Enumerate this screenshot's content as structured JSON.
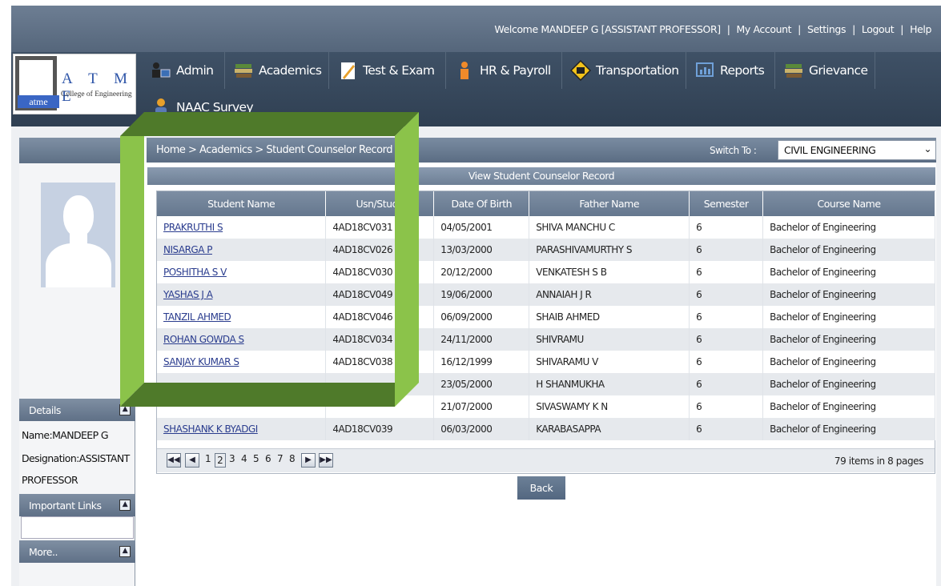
{
  "header": {
    "welcome": "Welcome MANDEEP G [ASSISTANT PROFESSOR]",
    "links": [
      "My Account",
      "Settings",
      "Logout",
      "Help"
    ]
  },
  "logo": {
    "letters": "A T M E",
    "subtitle": "College of Engineering",
    "badge": "atme"
  },
  "nav": [
    {
      "label": "Admin",
      "icon": "admin-users-icon"
    },
    {
      "label": "Academics",
      "icon": "books-icon"
    },
    {
      "label": "Test & Exam",
      "icon": "pencil-paper-icon"
    },
    {
      "label": "HR & Payroll",
      "icon": "person-icon"
    },
    {
      "label": "Transportation",
      "icon": "bus-sign-icon"
    },
    {
      "label": "Reports",
      "icon": "chart-icon"
    },
    {
      "label": "Grievance",
      "icon": "books-icon"
    },
    {
      "label": "NAAC Survey",
      "icon": "survey-icon"
    }
  ],
  "breadcrumb": "Home > Academics > Student Counselor Record",
  "switch": {
    "label": "Switch To :",
    "value": "CIVIL ENGINEERING"
  },
  "section_title": "View Student Counselor Record",
  "table": {
    "headers": [
      "Student Name",
      "Usn/Stude",
      "Date Of Birth",
      "Father Name",
      "Semester",
      "Course Name"
    ],
    "rows": [
      [
        "PRAKRUTHI S",
        "4AD18CV031",
        "04/05/2001",
        "SHIVA MANCHU C",
        "6",
        "Bachelor of Engineering"
      ],
      [
        "NISARGA P",
        "4AD18CV026",
        "13/03/2000",
        "PARASHIVAMURTHY S",
        "6",
        "Bachelor of Engineering"
      ],
      [
        "POSHITHA S V",
        "4AD18CV030",
        "20/12/2000",
        "VENKATESH S B",
        "6",
        "Bachelor of Engineering"
      ],
      [
        "YASHAS J A",
        "4AD18CV049",
        "19/06/2000",
        "ANNAIAH J R",
        "6",
        "Bachelor of Engineering"
      ],
      [
        "TANZIL AHMED",
        "4AD18CV046",
        "06/09/2000",
        "SHAIB AHMED",
        "6",
        "Bachelor of Engineering"
      ],
      [
        "ROHAN GOWDA S",
        "4AD18CV034",
        "24/11/2000",
        "SHIVRAMU",
        "6",
        "Bachelor of Engineering"
      ],
      [
        "SANJAY KUMAR S",
        "4AD18CV038",
        "16/12/1999",
        "SHIVARAMU V",
        "6",
        "Bachelor of Engineering"
      ],
      [
        "",
        "",
        "23/05/2000",
        "H SHANMUKHA",
        "6",
        "Bachelor of Engineering"
      ],
      [
        "",
        "",
        "21/07/2000",
        "SIVASWAMY K N",
        "6",
        "Bachelor of Engineering"
      ],
      [
        "SHASHANK K BYADGI",
        "4AD18CV039",
        "06/03/2000",
        "KARABASAPPA",
        "6",
        "Bachelor of Engineering"
      ]
    ]
  },
  "pager": {
    "pages": [
      "1",
      "2",
      "3",
      "4",
      "5",
      "6",
      "7",
      "8"
    ],
    "current": "2",
    "info": "79 items in 8 pages"
  },
  "back_label": "Back",
  "sidebar": {
    "details_title": "Details",
    "name_line": "Name:MANDEEP G",
    "designation_line": "Designation:ASSISTANT",
    "designation_line2": "PROFESSOR",
    "important_links": "Important Links",
    "more": "More.."
  },
  "colors": {
    "highlight": "#6f9a3c",
    "nav": "#3f5166",
    "link": "#2a3c8e"
  }
}
